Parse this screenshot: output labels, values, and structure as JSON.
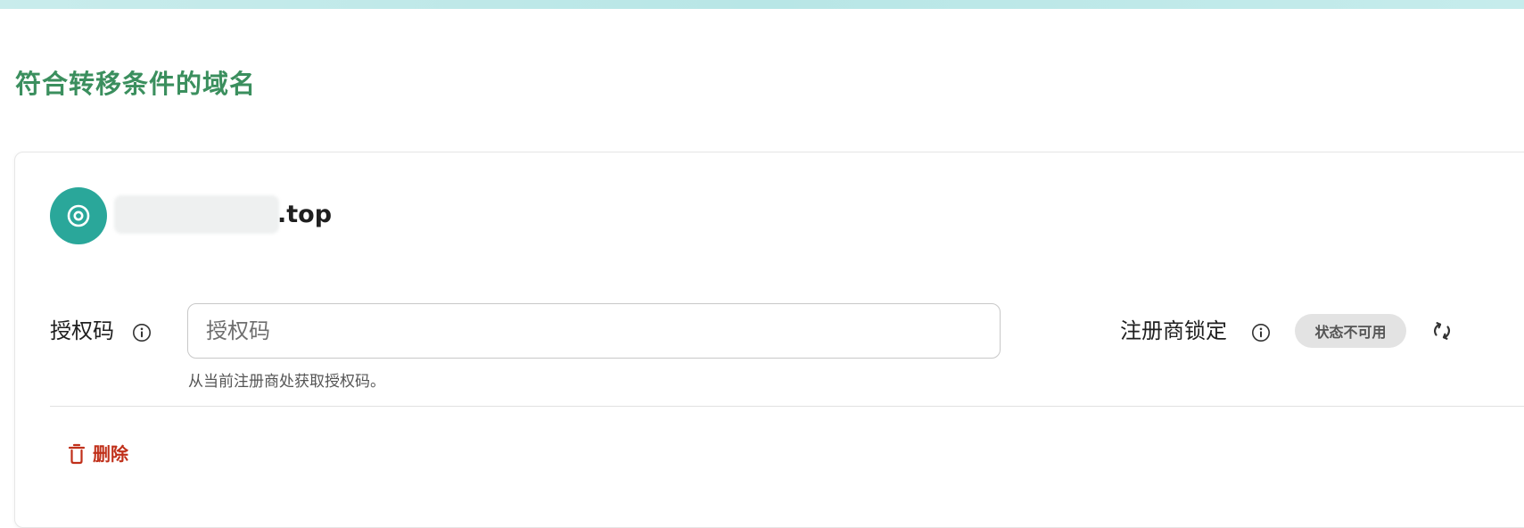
{
  "page": {
    "title": "符合转移条件的域名"
  },
  "domain": {
    "suffix": ".top",
    "icon": "domain-target-icon"
  },
  "auth_code": {
    "label": "授权码",
    "placeholder": "授权码",
    "value": "",
    "helper": "从当前注册商处获取授权码。",
    "info_icon": "info-icon"
  },
  "registrar_lock": {
    "label": "注册商锁定",
    "status": "状态不可用",
    "info_icon": "info-icon",
    "refresh_icon": "refresh-icon"
  },
  "actions": {
    "delete_label": "删除",
    "delete_icon": "trash-icon"
  },
  "colors": {
    "title_green": "#3b8f5e",
    "avatar_teal": "#2aa79a",
    "delete_red": "#c0301a",
    "badge_gray": "#e3e3e3"
  }
}
